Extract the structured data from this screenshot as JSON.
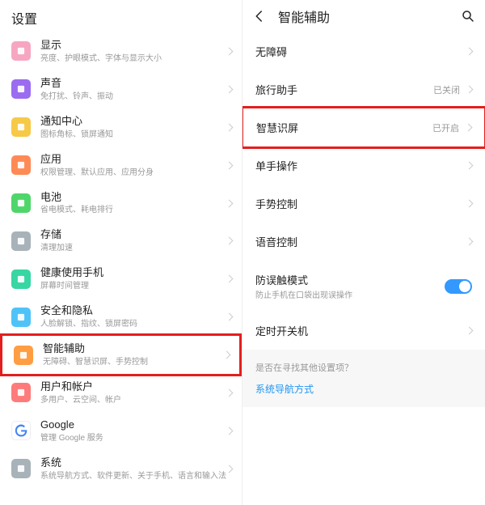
{
  "left": {
    "title": "设置",
    "items": [
      {
        "title": "显示",
        "sub": "亮度、护眼模式、字体与显示大小",
        "iconColor": "#f7a6c2",
        "iconName": "display-icon"
      },
      {
        "title": "声音",
        "sub": "免打扰、铃声、振动",
        "iconColor": "#9b6cf0",
        "iconName": "sound-icon"
      },
      {
        "title": "通知中心",
        "sub": "图标角标、锁屏通知",
        "iconColor": "#f7c948",
        "iconName": "notification-icon"
      },
      {
        "title": "应用",
        "sub": "权限管理、默认应用、应用分身",
        "iconColor": "#ff8a56",
        "iconName": "apps-icon"
      },
      {
        "title": "电池",
        "sub": "省电模式、耗电排行",
        "iconColor": "#4fd66b",
        "iconName": "battery-icon"
      },
      {
        "title": "存储",
        "sub": "清理加速",
        "iconColor": "#a8b2b9",
        "iconName": "storage-icon"
      },
      {
        "title": "健康使用手机",
        "sub": "屏幕时间管理",
        "iconColor": "#37d6a2",
        "iconName": "health-icon"
      },
      {
        "title": "安全和隐私",
        "sub": "人脸解锁、指纹、锁屏密码",
        "iconColor": "#4fc3f7",
        "iconName": "security-icon"
      },
      {
        "title": "智能辅助",
        "sub": "无障碍、智慧识屏、手势控制",
        "iconColor": "#ff9d42",
        "iconName": "assist-icon",
        "highlight": true
      },
      {
        "title": "用户和帐户",
        "sub": "多用户、云空间、帐户",
        "iconColor": "#ff7b7b",
        "iconName": "user-icon"
      },
      {
        "title": "Google",
        "sub": "管理 Google 服务",
        "iconColor": "#ffffff",
        "iconName": "google-icon"
      },
      {
        "title": "系统",
        "sub": "系统导航方式、软件更新、关于手机、语言和输入法",
        "iconColor": "#a8b2b9",
        "iconName": "system-icon"
      }
    ]
  },
  "right": {
    "title": "智能辅助",
    "items": [
      {
        "title": "无障碍"
      },
      {
        "title": "旅行助手",
        "status": "已关闭"
      },
      {
        "title": "智慧识屏",
        "status": "已开启",
        "highlight": true
      },
      {
        "title": "单手操作"
      },
      {
        "title": "手势控制"
      },
      {
        "title": "语音控制"
      },
      {
        "title": "防误触模式",
        "sub": "防止手机在口袋出现误操作",
        "toggle": true
      },
      {
        "title": "定时开关机"
      }
    ],
    "footer": {
      "text": "是否在寻找其他设置项？",
      "link": "系统导航方式"
    }
  }
}
